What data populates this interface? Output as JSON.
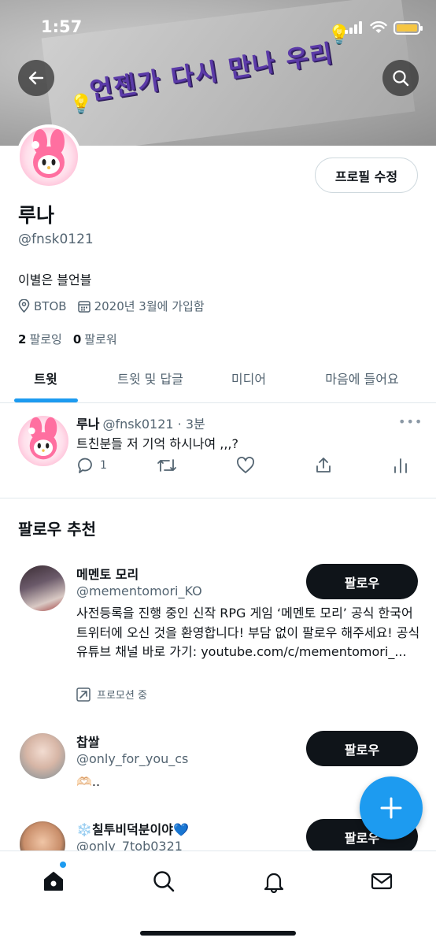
{
  "status": {
    "time": "1:57"
  },
  "banner": {
    "text": "언젠가 다시 만나 우리"
  },
  "profile": {
    "name": "루나",
    "handle": "@fnsk0121",
    "bio": "이별은 블언블",
    "location": "BTOB",
    "joined": "2020년 3월에 가입함",
    "following_count": "2",
    "following_label": "팔로잉",
    "followers_count": "0",
    "followers_label": "팔로워",
    "edit_label": "프로필 수정"
  },
  "tabs": [
    {
      "label": "트윗",
      "active": true
    },
    {
      "label": "트윗 및 답글",
      "active": false
    },
    {
      "label": "미디어",
      "active": false
    },
    {
      "label": "마음에 들어요",
      "active": false
    }
  ],
  "tweet": {
    "name": "루나",
    "handle": "@fnsk0121",
    "time": "· 3분",
    "text": "트친분들 저 기억 하시나여 ,,,?",
    "reply_count": "1"
  },
  "who_to_follow": {
    "title": "팔로우 추천",
    "follow_label": "팔로우",
    "accounts": [
      {
        "name": "메멘토 모리",
        "handle": "@mementomori_KO",
        "description": "사전등록을 진행 중인 신작 RPG 게임 ‘메멘토 모리’ 공식 한국어 트위터에 오신 것을 환영합니다! 부담 없이 팔로우 해주세요! 공식 유튜브 채널 바로 가기: youtube.com/c/mementomori_...",
        "promoted_label": "프로모션 중"
      },
      {
        "name": "찹쌀",
        "handle": "@only_for_you_cs",
        "description": "🫶🏻.."
      },
      {
        "name": "❄️칠투비덕분이야💙",
        "handle": "@only_7tob0321"
      }
    ]
  },
  "colors": {
    "accent": "#1d9bf0",
    "text": "#0f1419",
    "muted": "#536471",
    "banner_text": "#5b3aa8"
  }
}
